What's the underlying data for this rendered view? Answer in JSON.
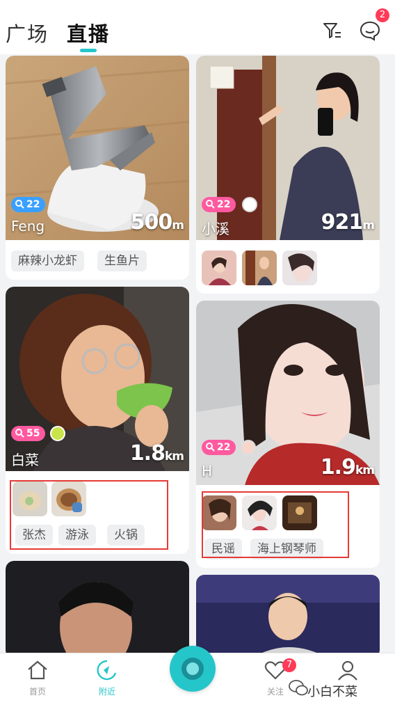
{
  "header": {
    "tabs": [
      {
        "label": "广场"
      },
      {
        "label": "直播"
      }
    ],
    "message_badge": "2",
    "icons": {
      "filter": "filter-icon",
      "message": "message-icon"
    }
  },
  "colors": {
    "accent": "#25c6c9",
    "badge": "#ff3b57",
    "annotation": "#e53935"
  },
  "cards": [
    {
      "level": "22",
      "level_icon": "level-icon",
      "level_color": "#3aa0ff",
      "name": "Feng",
      "distance": "500",
      "unit": "m",
      "tags": [
        "麻辣小龙虾",
        "生鱼片"
      ]
    },
    {
      "level": "22",
      "level_icon": "level-icon",
      "level_color": "#ff5aa0",
      "name": "小溪",
      "distance": "921",
      "unit": "m",
      "thumb_count": 3
    },
    {
      "level": "55",
      "level_icon": "level-icon",
      "level_color": "#ff5aa0",
      "name": "白菜",
      "distance": "1.8",
      "unit": "km",
      "tags": [
        "张杰",
        "游泳",
        "火锅"
      ]
    },
    {
      "level": "22",
      "level_icon": "level-icon",
      "level_color": "#ff5aa0",
      "name": "H",
      "distance": "1.9",
      "unit": "km",
      "tags": [
        "民谣",
        "海上钢琴师"
      ]
    }
  ],
  "bottom_nav": {
    "items": [
      {
        "label": "首页",
        "icon": "home-icon"
      },
      {
        "label": "附近",
        "icon": "nearby-icon"
      },
      {
        "label": "关注",
        "icon": "heart-icon",
        "badge": "7"
      },
      {
        "label": "我",
        "icon": "profile-icon"
      }
    ],
    "watermark": "小白不菜"
  }
}
